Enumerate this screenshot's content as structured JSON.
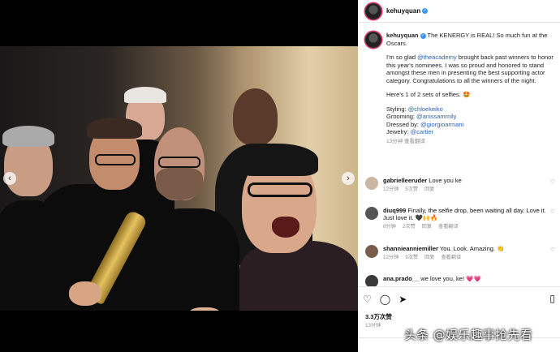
{
  "post": {
    "username": "kehuyquan",
    "caption": {
      "username": "kehuyquan",
      "line1": "The KENERGY is REAL! So much fun at the Oscars.",
      "para2_a": "I'm so glad ",
      "para2_mention": "@theacademy",
      "para2_b": " brought back past winners to honor this year's nominees. I was so proud and honored to stand amongst these men in presenting the best supporting actor category. Congratulations to all the winners of the night.",
      "para3": "Here's 1 of 2 sets of selfies. 🤩",
      "styling_label": "Styling: ",
      "styling": "@chloekeiko",
      "grooming_label": "Grooming: ",
      "grooming": "@anissamrnily",
      "dressed_label": "Dressed by: ",
      "dressed": "@giorgioarmani",
      "jewelry_label": "Jewelry: ",
      "jewelry": "@cartier",
      "time": "13分钟",
      "translate": "查看翻译"
    },
    "comments": [
      {
        "user": "gabrielleeruder",
        "text": "Love you ke",
        "time": "12分钟",
        "likes": "5次赞",
        "reply": "回复",
        "av": "#c9b7a1"
      },
      {
        "user": "diuq999",
        "text": "Finally, the selfie drop, been waiting all day. Love it. Just love it. 🖤🙌🔥",
        "time": "8分钟",
        "likes": "2次赞",
        "reply": "回复",
        "translate": "查看翻译",
        "av": "#555"
      },
      {
        "user": "shannieanniemiller",
        "text": "You. Look. Amazing. 👏",
        "time": "12分钟",
        "likes": "9次赞",
        "reply": "回复",
        "translate": "查看翻译",
        "av": "#7a5c4a"
      },
      {
        "user": "ana.prado__",
        "text": "we love you, ke! 💗💗",
        "av": "#3a3a3a"
      }
    ],
    "likes_count": "3.3万次赞",
    "posted": "13分钟",
    "carousel": {
      "prev": "‹",
      "next": "›",
      "dots": 7,
      "active_dot": 2
    }
  },
  "watermark": "头条 @娱乐趣事抢先看",
  "icons": {
    "like": "heart-icon",
    "comment": "comment-icon",
    "share": "send-icon",
    "save": "bookmark-icon"
  }
}
